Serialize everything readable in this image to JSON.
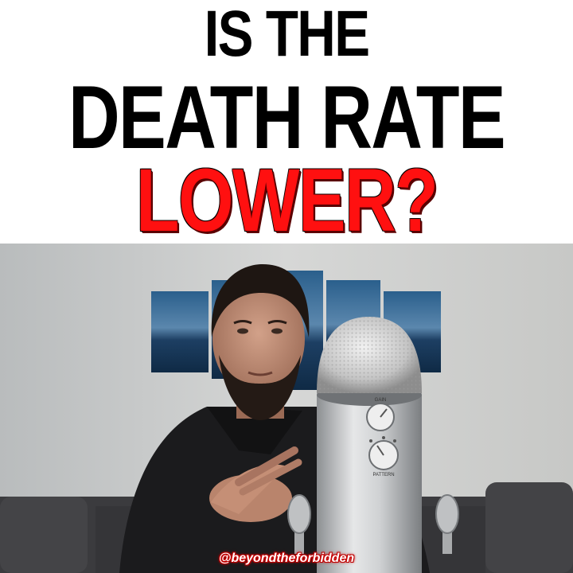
{
  "headline": {
    "line1": "IS THE",
    "line2": "DEATH RATE",
    "line3": "LOWER?",
    "color_primary": "#000000",
    "color_accent": "#ff1010"
  },
  "video": {
    "mic_labels": {
      "gain": "GAIN",
      "pattern": "PATTERN"
    },
    "handle": "@beyondtheforbidden"
  }
}
